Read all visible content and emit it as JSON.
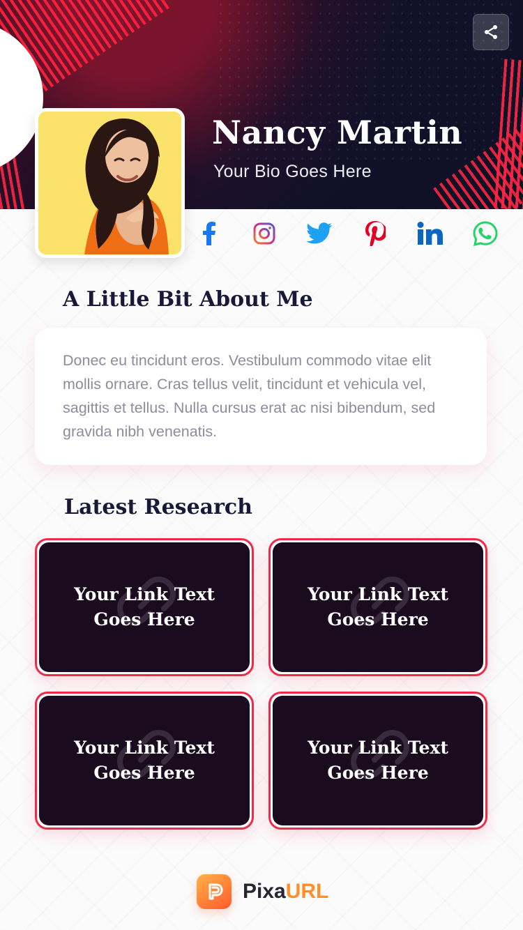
{
  "profile": {
    "name": "Nancy Martin",
    "bio": "Your Bio Goes Here"
  },
  "header": {
    "share_icon": "share-icon"
  },
  "social": {
    "items": [
      {
        "name": "facebook",
        "icon": "facebook-icon",
        "color": "#1877F2"
      },
      {
        "name": "instagram",
        "icon": "instagram-icon",
        "color": "#E4405F"
      },
      {
        "name": "twitter",
        "icon": "twitter-icon",
        "color": "#1DA1F2"
      },
      {
        "name": "pinterest",
        "icon": "pinterest-icon",
        "color": "#E60023"
      },
      {
        "name": "linkedin",
        "icon": "linkedin-icon",
        "color": "#0A66C2"
      },
      {
        "name": "whatsapp",
        "icon": "whatsapp-icon",
        "color": "#25D366"
      }
    ]
  },
  "about": {
    "title": "A Little Bit About Me",
    "text": "Donec eu tincidunt eros. Vestibulum commodo vitae elit mollis ornare. Cras tellus velit, tincidunt et vehicula vel, sagittis et tellus. Nulla cursus erat ac nisi bibendum, sed gravida nibh venenatis."
  },
  "research": {
    "title": "Latest Research",
    "cards": [
      {
        "label": "Your Link Text\nGoes Here"
      },
      {
        "label": "Your Link Text\nGoes Here"
      },
      {
        "label": "Your Link Text\nGoes Here"
      },
      {
        "label": "Your Link Text\nGoes Here"
      }
    ]
  },
  "footer": {
    "brand_part_1": "Pixa",
    "brand_part_2": "URL",
    "logo_icon": "pixaurl-logo-icon"
  },
  "colors": {
    "accent": "#EF2A49",
    "header_dark": "#12112A",
    "card_dark": "#1A0B1F",
    "brand_orange": "#FF8E2B"
  }
}
